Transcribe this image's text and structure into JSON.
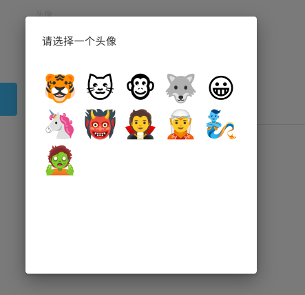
{
  "background": {
    "label": "头像"
  },
  "dialog": {
    "title": "请选择一个头像",
    "avatars": [
      {
        "name": "tiger-face",
        "glyph": "🐯"
      },
      {
        "name": "cat-face",
        "glyph": "🐱"
      },
      {
        "name": "chimpanzee",
        "glyph": "🐵"
      },
      {
        "name": "wolf-face",
        "glyph": "🐺"
      },
      {
        "name": "grinning-face",
        "glyph": "😀"
      },
      {
        "name": "unicorn-face",
        "glyph": "🦄"
      },
      {
        "name": "ogre",
        "glyph": "👹"
      },
      {
        "name": "vampire",
        "glyph": "🧛"
      },
      {
        "name": "elf",
        "glyph": "🧝"
      },
      {
        "name": "genie",
        "glyph": "🧞"
      },
      {
        "name": "zombie",
        "glyph": "🧟"
      }
    ]
  }
}
